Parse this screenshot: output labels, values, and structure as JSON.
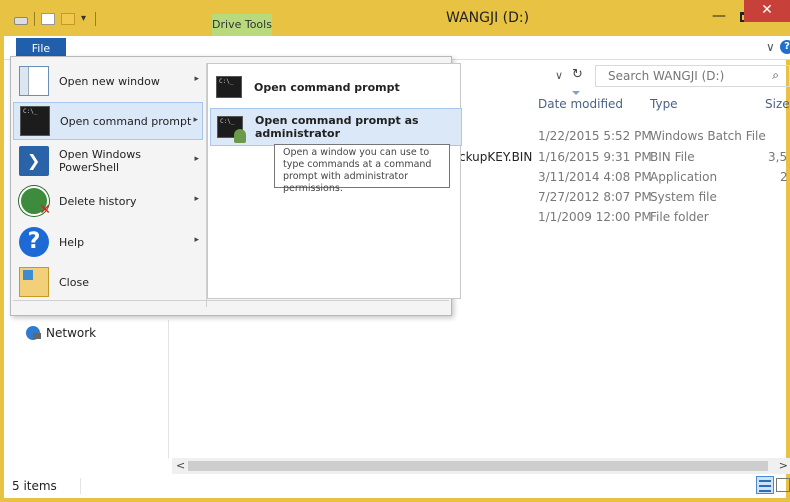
{
  "window": {
    "title": "WANGJI (D:)",
    "contextual_tab": "Drive Tools",
    "minimize": "—",
    "close": "✕"
  },
  "ribbon": {
    "file_tab": "File",
    "expand": "∨",
    "help": "?"
  },
  "address": {
    "dropdown": "∨",
    "refresh": "↻",
    "search_placeholder": "Search WANGJI (D:)"
  },
  "columns": {
    "date_modified": "Date modified",
    "type": "Type",
    "size": "Size"
  },
  "files": [
    {
      "name": "",
      "date": "1/22/2015 5:52 PM",
      "type": "Windows Batch File",
      "size": ""
    },
    {
      "name": "ckupKEY.BIN",
      "date": "1/16/2015 9:31 PM",
      "type": "BIN File",
      "size": "3,5"
    },
    {
      "name": "",
      "date": "3/11/2014 4:08 PM",
      "type": "Application",
      "size": "2"
    },
    {
      "name": "",
      "date": "7/27/2012 8:07 PM",
      "type": "System file",
      "size": ""
    },
    {
      "name": "",
      "date": "1/1/2009 12:00 PM",
      "type": "File folder",
      "size": ""
    }
  ],
  "nav": {
    "network": "Network"
  },
  "status": {
    "count": "5 items"
  },
  "file_menu": {
    "items": [
      {
        "label": "Open new window",
        "icon": "new-window-icon"
      },
      {
        "label": "Open command prompt",
        "icon": "command-prompt-icon"
      },
      {
        "label": "Open Windows PowerShell",
        "icon": "powershell-icon"
      },
      {
        "label": "Delete history",
        "icon": "delete-history-icon"
      },
      {
        "label": "Help",
        "icon": "help-icon"
      },
      {
        "label": "Close",
        "icon": "close-folder-icon"
      }
    ],
    "submenu": [
      {
        "label": "Open command prompt"
      },
      {
        "label": "Open command prompt as administrator"
      }
    ],
    "tooltip": "Open a window you can use to type commands at a command prompt with administrator permissions."
  },
  "colors": {
    "titlebar": "#e7c243",
    "file_tab": "#1f5fac",
    "drive_tools": "#b9da7c",
    "close_button": "#c8403a",
    "menu_highlight": "#dbe8f7"
  }
}
